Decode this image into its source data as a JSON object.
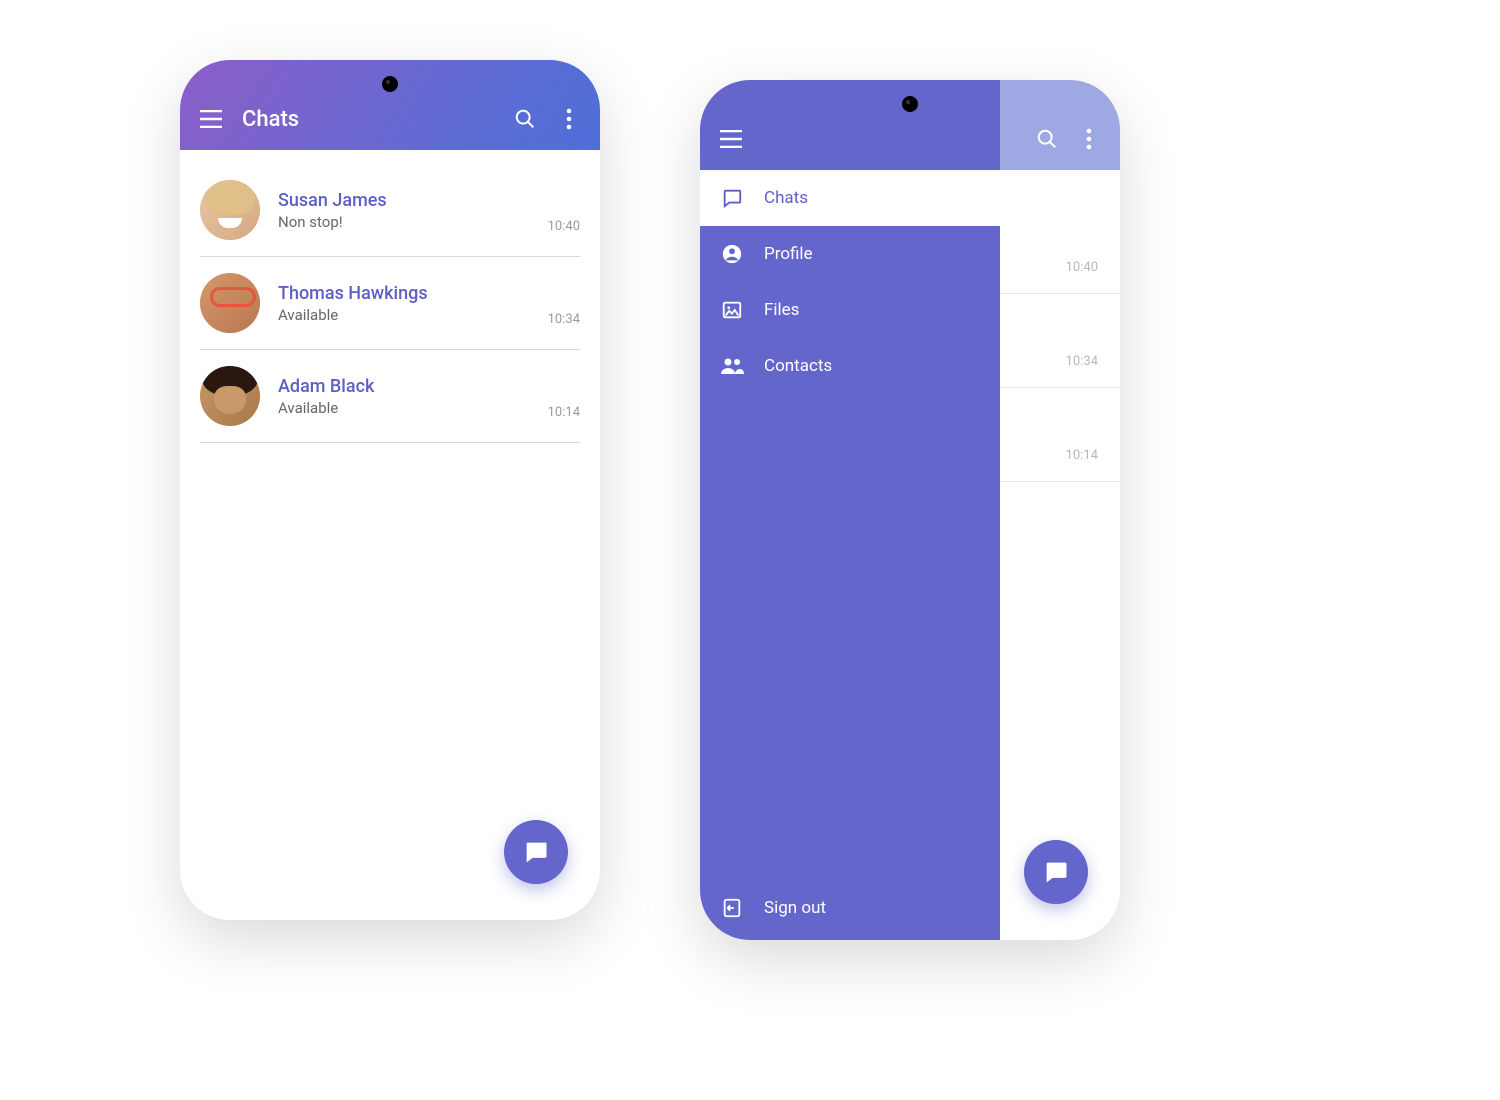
{
  "colors": {
    "primary": "#6466cb",
    "accent": "#5c5fc6",
    "header_gradient_start": "#8c5ec9",
    "header_gradient_end": "#4e6fd8",
    "drawer_header_light": "#9ea8e2"
  },
  "header": {
    "title": "Chats"
  },
  "chats": [
    {
      "name": "Susan James",
      "status": "Non stop!",
      "time": "10:40"
    },
    {
      "name": "Thomas Hawkings",
      "status": "Available",
      "time": "10:34"
    },
    {
      "name": "Adam Black",
      "status": "Available",
      "time": "10:14"
    }
  ],
  "drawer": {
    "items": [
      {
        "label": "Chats",
        "icon": "chat-outline-icon",
        "active": true
      },
      {
        "label": "Profile",
        "icon": "account-circle-icon",
        "active": false
      },
      {
        "label": "Files",
        "icon": "image-icon",
        "active": false
      },
      {
        "label": "Contacts",
        "icon": "people-icon",
        "active": false
      }
    ],
    "signout_label": "Sign out"
  },
  "bg_times": [
    "10:40",
    "10:34",
    "10:14"
  ]
}
